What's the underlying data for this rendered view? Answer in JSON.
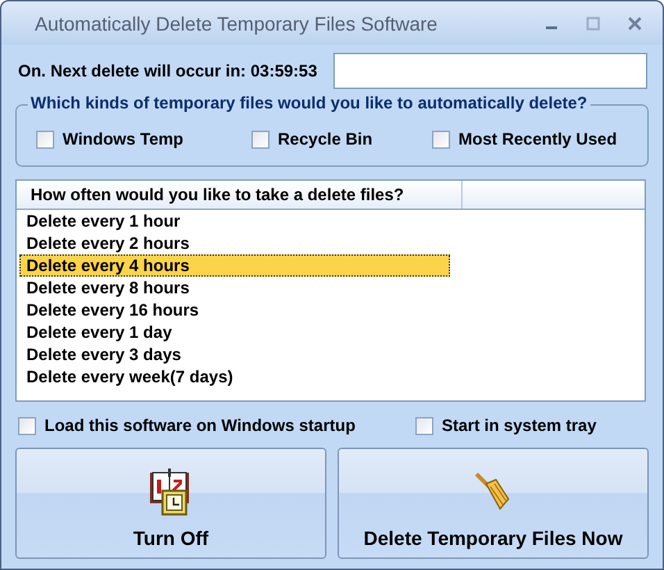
{
  "window": {
    "title": "Automatically Delete Temporary Files Software"
  },
  "status": {
    "text": "On. Next delete will occur in: 03:59:53"
  },
  "file_types": {
    "legend": "Which kinds of temporary files would you like to automatically delete?",
    "options": [
      {
        "label": "Windows Temp",
        "checked": false
      },
      {
        "label": "Recycle Bin",
        "checked": false
      },
      {
        "label": "Most Recently Used",
        "checked": false
      }
    ]
  },
  "frequency": {
    "column": "How often would you like to take a delete files?",
    "items": [
      {
        "label": "Delete every 1 hour",
        "selected": false
      },
      {
        "label": "Delete every 2 hours",
        "selected": false
      },
      {
        "label": "Delete every 4 hours",
        "selected": true
      },
      {
        "label": "Delete every 8 hours",
        "selected": false
      },
      {
        "label": "Delete every 16 hours",
        "selected": false
      },
      {
        "label": "Delete every 1 day",
        "selected": false
      },
      {
        "label": "Delete every 3 days",
        "selected": false
      },
      {
        "label": "Delete every week(7 days)",
        "selected": false
      }
    ]
  },
  "options": [
    {
      "label": "Load this software on Windows startup",
      "checked": false
    },
    {
      "label": "Start in system tray",
      "checked": false
    }
  ],
  "buttons": [
    {
      "label": "Turn Off",
      "kind": "calendar"
    },
    {
      "label": "Delete Temporary Files Now",
      "kind": "broom"
    }
  ]
}
